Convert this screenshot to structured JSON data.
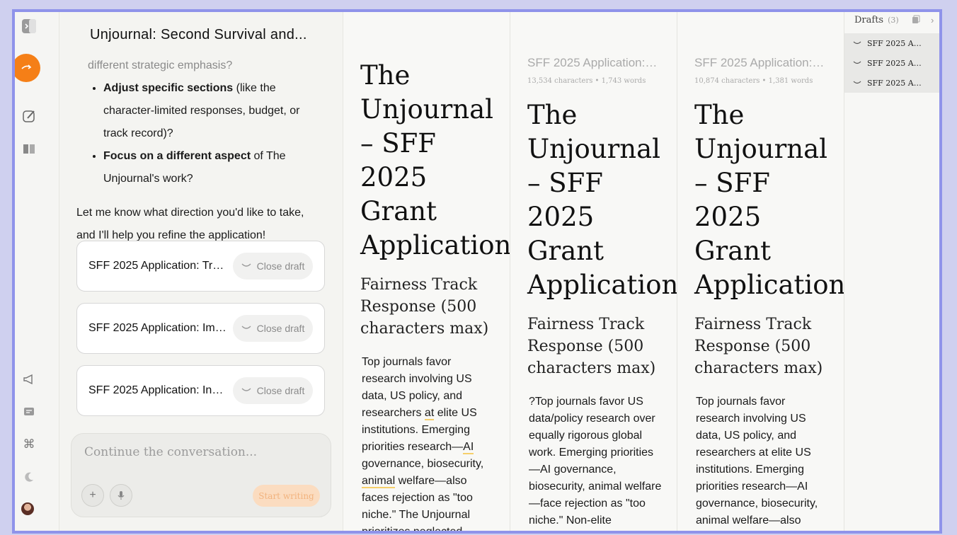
{
  "chat": {
    "title": "Unjournal: Second Survival and...",
    "faded_line": "different strategic emphasis?",
    "bullets": [
      {
        "bold": "Adjust specific sections",
        "rest": " (like the character-limited responses, budget, or track record)?"
      },
      {
        "bold": "Focus on a different aspect",
        "rest": " of The Unjournal's work?"
      }
    ],
    "closing": "Let me know what direction you'd like to take, and I'll help you refine the application!",
    "draft_cards": [
      {
        "title": "SFF 2025 Application: Tra...",
        "close_label": "Close draft"
      },
      {
        "title": "SFF 2025 Application: Imp...",
        "close_label": "Close draft"
      },
      {
        "title": "SFF 2025 Application: Inn...",
        "close_label": "Close draft"
      }
    ],
    "composer": {
      "placeholder": "Continue the conversation...",
      "start_label": "Start writing"
    }
  },
  "docs": [
    {
      "meta_title": "",
      "meta_count": "",
      "heading": "The Unjournal – SFF 2025 Grant Application",
      "subheading": "Fairness Track Response (500 characters max)",
      "body_parts": [
        "Top journals favor research involving US data, US policy, and researchers ",
        "at",
        " elite US institutions. Emerging priorities research—",
        "AI",
        " governance, biosecurity, ",
        "animal",
        " welfare—also faces rejection as \"too niche.\" The Unjournal prioritizes neglected"
      ]
    },
    {
      "meta_title": "SFF 2025 Application: I...",
      "meta_count": "13,534 characters • 1,743 words",
      "heading": "The Unjournal – SFF 2025 Grant Application",
      "subheading": "Fairness Track Response (500 characters max)",
      "body": "?Top journals favor US data/policy research over equally rigorous global work. Emerging priorities —AI governance, biosecurity, animal welfare—face rejection as \"too niche.\" Non-elite"
    },
    {
      "meta_title": "SFF 2025 Application: I...",
      "meta_count": "10,874 characters • 1,381 words",
      "heading": "The Unjournal – SFF 2025 Grant Application",
      "subheading": "Fairness Track Response (500 characters max)",
      "body": "Top journals favor research involving US data, US policy, and researchers at elite US institutions. Emerging priorities research—AI governance, biosecurity, animal welfare—also"
    }
  ],
  "drafts_panel": {
    "label": "Drafts",
    "count": "(3)",
    "items": [
      "SFF 2025 App...",
      "SFF 2025 App...",
      "SFF 2025 App..."
    ]
  },
  "colors": {
    "accent": "#f57f17",
    "frame": "#8f93ea",
    "underline": "#f6cf6a"
  }
}
